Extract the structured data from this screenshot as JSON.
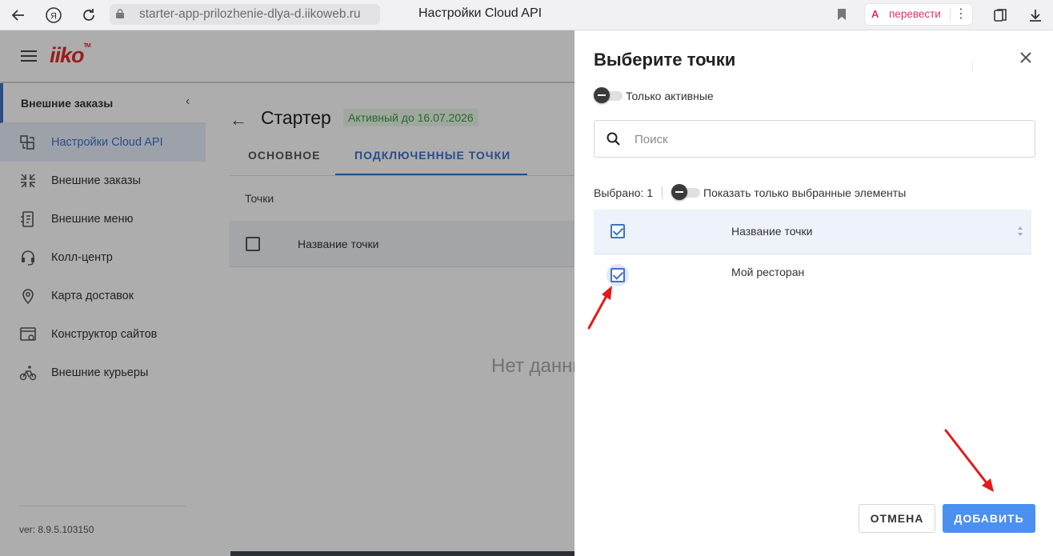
{
  "browser": {
    "address": "starter-app-prilozhenie-dlya-d.iikoweb.ru",
    "tab_title": "Настройки Cloud API",
    "translate_label": "перевести"
  },
  "app": {
    "logo": "iiko"
  },
  "sidebar": {
    "section_label": "Внешние заказы",
    "items": [
      {
        "label": "Настройки Cloud API",
        "icon": "cloud-api-icon",
        "active": true
      },
      {
        "label": "Внешние заказы",
        "icon": "external-orders-icon"
      },
      {
        "label": "Внешние меню",
        "icon": "external-menu-icon"
      },
      {
        "label": "Колл-центр",
        "icon": "headset-icon"
      },
      {
        "label": "Карта доставок",
        "icon": "map-pin-icon"
      },
      {
        "label": "Конструктор сайтов",
        "icon": "site-builder-icon"
      },
      {
        "label": "Внешние курьеры",
        "icon": "courier-icon"
      }
    ],
    "version": "ver: 8.9.5.103150"
  },
  "main": {
    "title": "Стартер",
    "status_badge": "Активный до 16.07.2026",
    "tabs": [
      {
        "label": "ОСНОВНОЕ"
      },
      {
        "label": "ПОДКЛЮЧЕННЫЕ ТОЧКИ",
        "active": true
      }
    ],
    "points_label": "Точки",
    "table_header": "Название точки",
    "no_data": "Нет данных"
  },
  "dialog": {
    "title": "Выберите точки",
    "only_active_label": "Только активные",
    "search_placeholder": "Поиск",
    "selected_count": "Выбрано: 1",
    "show_selected_label": "Показать только выбранные элементы",
    "table_header": "Название точки",
    "rows": [
      {
        "name": "Мой ресторан",
        "checked": true
      }
    ],
    "cancel_label": "ОТМЕНА",
    "add_label": "ДОБАВИТЬ"
  },
  "colors": {
    "accent": "#3f72c6",
    "primary_button": "#4a90f0",
    "logo": "#e32b2b",
    "badge_text": "#3b9b3f",
    "annotation_arrow": "#e31a1a"
  }
}
